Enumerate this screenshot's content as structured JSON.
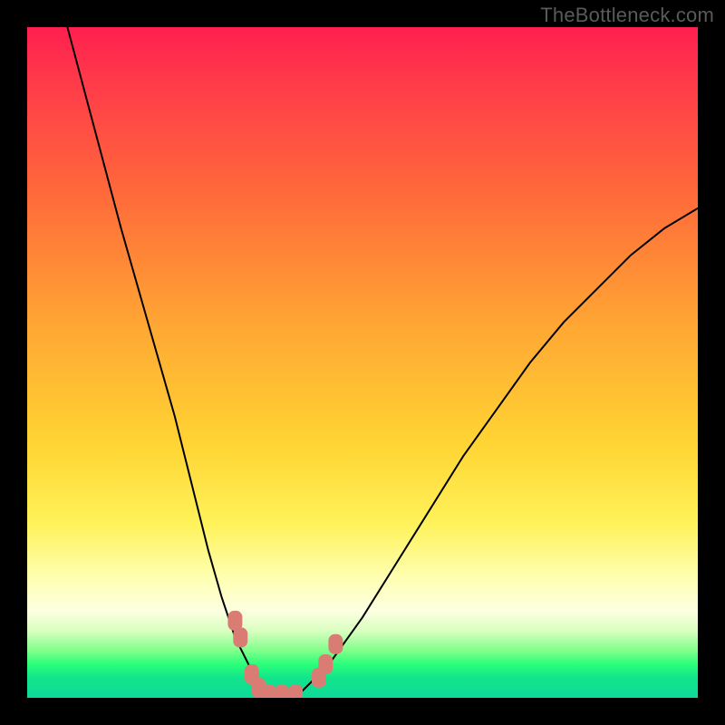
{
  "watermark": "TheBottleneck.com",
  "chart_data": {
    "type": "line",
    "title": "",
    "xlabel": "",
    "ylabel": "",
    "xlim": [
      0,
      100
    ],
    "ylim": [
      0,
      100
    ],
    "legend": false,
    "grid": false,
    "background_gradient": {
      "direction": "vertical",
      "stops": [
        {
          "pos": 0.0,
          "color": "#ff1f4f"
        },
        {
          "pos": 0.25,
          "color": "#ff6a3a"
        },
        {
          "pos": 0.45,
          "color": "#ffa833"
        },
        {
          "pos": 0.62,
          "color": "#ffd433"
        },
        {
          "pos": 0.82,
          "color": "#feffb0"
        },
        {
          "pos": 0.93,
          "color": "#7fff8a"
        },
        {
          "pos": 1.0,
          "color": "#0fd99a"
        }
      ]
    },
    "series": [
      {
        "name": "bottleneck-curve",
        "stroke": "#000000",
        "stroke_width": 2,
        "x": [
          6,
          10,
          14,
          18,
          22,
          25,
          27,
          29,
          31,
          33,
          35,
          37,
          39,
          41,
          45,
          50,
          55,
          60,
          65,
          70,
          75,
          80,
          85,
          90,
          95,
          100
        ],
        "y": [
          100,
          85,
          70,
          56,
          42,
          30,
          22,
          15,
          9,
          5,
          2,
          0,
          0,
          1,
          5,
          12,
          20,
          28,
          36,
          43,
          50,
          56,
          61,
          66,
          70,
          73
        ]
      }
    ],
    "markers": {
      "name": "highlighted-points",
      "color": "#d97d74",
      "shape": "rounded-rect",
      "points": [
        {
          "x": 31.0,
          "y": 11.5
        },
        {
          "x": 31.8,
          "y": 9.0
        },
        {
          "x": 33.5,
          "y": 3.5
        },
        {
          "x": 34.5,
          "y": 1.5
        },
        {
          "x": 36.0,
          "y": 0.5
        },
        {
          "x": 38.0,
          "y": 0.5
        },
        {
          "x": 40.0,
          "y": 0.5
        },
        {
          "x": 43.5,
          "y": 3.0
        },
        {
          "x": 44.5,
          "y": 5.0
        },
        {
          "x": 46.0,
          "y": 8.0
        }
      ]
    }
  }
}
